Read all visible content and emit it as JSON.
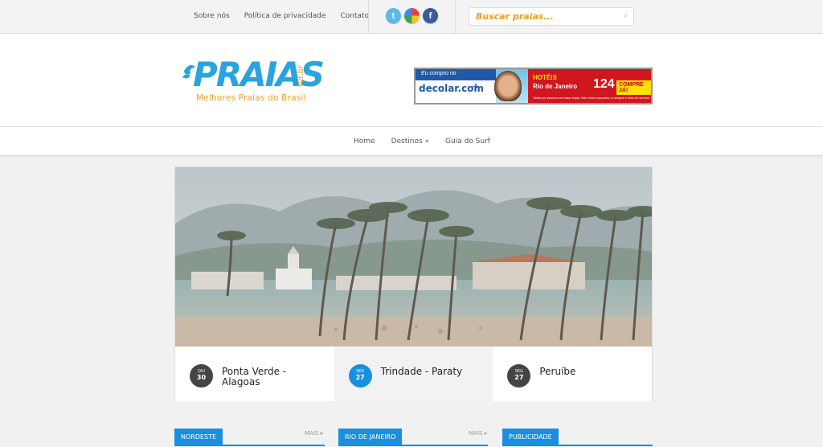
{
  "topbar": {
    "links": [
      "Sobre nós",
      "Política de privacidade",
      "Contato"
    ],
    "social": [
      {
        "name": "twitter-icon",
        "glyph": "t"
      },
      {
        "name": "google-icon",
        "glyph": "g"
      },
      {
        "name": "facebook-icon",
        "glyph": "f"
      }
    ],
    "search_placeholder": "Buscar praias...",
    "search_icon": "⌕"
  },
  "logo": {
    "word": "PRAIAS",
    "tld": "tur.br",
    "tagline": "Melhores Praias do Brasil"
  },
  "banner": {
    "lead": "Eu compro no",
    "brand": "decolar.com",
    "hotels": "HOTÉIS",
    "city": "Rio de Janeiro",
    "price": "124",
    "cta": "COMPRE JÁ!",
    "fine": "Tarifa por pessoa em base dupla. Não inclui impostos, encargos e taxa de serviço."
  },
  "nav": {
    "items": [
      "Home",
      "Destinos »",
      "Guia do Surf"
    ]
  },
  "slider": {
    "posts": [
      {
        "day": "QUI",
        "num": "30",
        "title": "Ponta Verde - Alagoas",
        "active": false
      },
      {
        "day": "SEG",
        "num": "27",
        "title": "Trindade - Paraty",
        "active": true
      },
      {
        "day": "SEG",
        "num": "27",
        "title": "Peruíbe",
        "active": false
      }
    ]
  },
  "sections": {
    "labels": [
      "NORDESTE",
      "RIO DE JANEIRO",
      "PUBLICIDADE"
    ],
    "more": "MAIS"
  },
  "colors": {
    "accent": "#1a8fe0",
    "logo_blue": "#2aa3de",
    "logo_orange": "#f0a020",
    "banner_red": "#d0161e"
  }
}
